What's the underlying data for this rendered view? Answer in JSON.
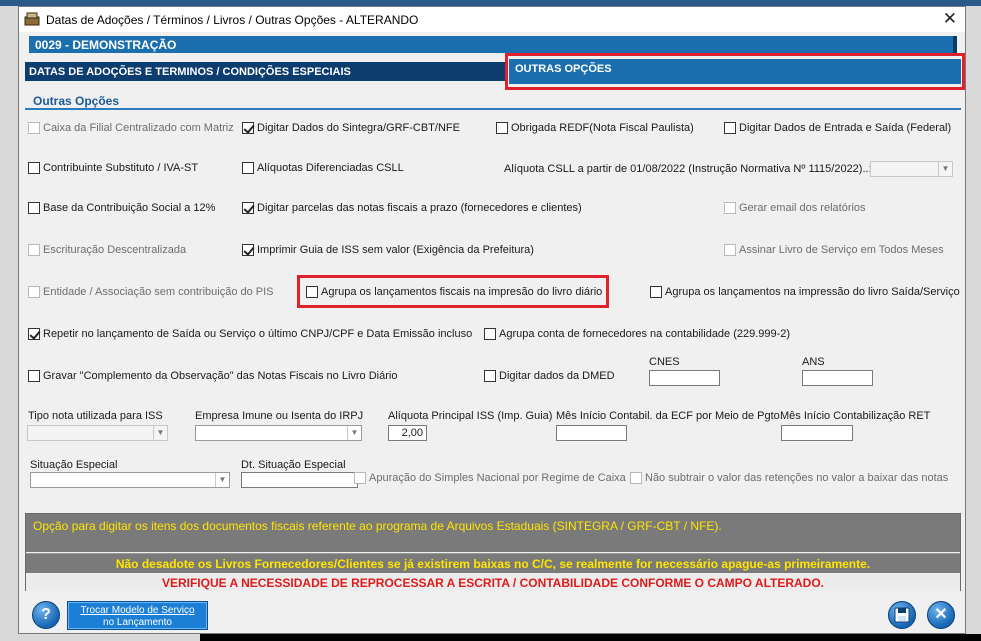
{
  "window": {
    "title": "Datas de Adoções / Términos / Livros / Outras Opções   -   ALTERANDO",
    "close_label": "✕"
  },
  "company": "0029  -  DEMONSTRAÇÃO",
  "tabs": {
    "dates": "DATAS DE ADOÇÕES E TERMINOS / CONDIÇÕES ESPECIAIS",
    "other": "OUTRAS OPÇÕES"
  },
  "section_title": "Outras Opções",
  "checkboxes": {
    "caixa_filial": {
      "label": "Caixa da Filial Centralizado com Matriz",
      "checked": false,
      "disabled": true
    },
    "digitar_sintegra": {
      "label": "Digitar Dados do Sintegra/GRF-CBT/NFE",
      "checked": true,
      "disabled": false
    },
    "obrigada_redf": {
      "label": "Obrigada REDF(Nota Fiscal Paulista)",
      "checked": false,
      "disabled": false
    },
    "digitar_entrada_saida": {
      "label": "Digitar Dados de Entrada e Saída (Federal)",
      "checked": false,
      "disabled": false
    },
    "contribuinte_substituto": {
      "label": "Contribuinte Substituto / IVA-ST",
      "checked": false,
      "disabled": false
    },
    "aliquotas_csll": {
      "label": "Alíquotas Diferenciadas CSLL",
      "checked": false,
      "disabled": false
    },
    "base_contribuicao": {
      "label": "Base da Contribuição Social a 12%",
      "checked": false,
      "disabled": false
    },
    "digitar_parcelas": {
      "label": "Digitar parcelas das notas fiscais a prazo (fornecedores e clientes)",
      "checked": true,
      "disabled": false
    },
    "gerar_email": {
      "label": "Gerar email dos relatórios",
      "checked": false,
      "disabled": true
    },
    "escrituracao": {
      "label": "Escrituração Descentralizada",
      "checked": false,
      "disabled": true
    },
    "imprimir_iss": {
      "label": "Imprimir Guia de ISS sem valor (Exigência da Prefeitura)",
      "checked": true,
      "disabled": false
    },
    "assinar_livro": {
      "label": "Assinar Livro de Serviço em Todos Meses",
      "checked": false,
      "disabled": true
    },
    "entidade": {
      "label": "Entidade / Associação sem contribuição do PIS",
      "checked": false,
      "disabled": true
    },
    "agrupa_diario": {
      "label": "Agrupa os lançamentos fiscais na impresão do livro diário",
      "checked": false,
      "disabled": false
    },
    "agrupa_saida": {
      "label": "Agrupa os lançamentos na impressão do livro Saída/Serviço",
      "checked": false,
      "disabled": false
    },
    "repetir": {
      "label": "Repetir no lançamento de Saída ou Serviço o último CNPJ/CPF e Data Emissão incluso",
      "checked": true,
      "disabled": false
    },
    "agrupa_fornecedores": {
      "label": "Agrupa conta de fornecedores na contabilidade (229.999-2)",
      "checked": false,
      "disabled": false
    },
    "gravar_complemento": {
      "label": "Gravar \"Complemento da Observação\" das Notas Fiscais no Livro Diário",
      "checked": false,
      "disabled": false
    },
    "digitar_dmed": {
      "label": "Digitar dados da DMED",
      "checked": false,
      "disabled": false
    },
    "apuracao_simples": {
      "label": "Apuração do Simples Nacional por Regime de Caixa",
      "checked": false,
      "disabled": true
    },
    "nao_subtrair": {
      "label": "Não subtrair o valor das retenções no valor a baixar das notas",
      "checked": false,
      "disabled": true
    }
  },
  "fields": {
    "aliquota_csll_label": "Alíquota CSLL a partir de 01/08/2022 (Instrução Normativa Nº 1115/2022)..:",
    "cnes_label": "CNES",
    "ans_label": "ANS",
    "tipo_nota_label": "Tipo nota utilizada para ISS",
    "empresa_imune_label": "Empresa Imune ou Isenta do IRPJ",
    "aliquota_principal_label": "Alíquota Principal ISS (Imp. Guia)",
    "aliquota_principal_value": "2,00",
    "mes_inicio_ecf_label": "Mês Início Contabil. da ECF por Meio de Pgto.",
    "mes_inicio_ret_label": "Mês Início Contabilização RET",
    "situacao_especial_label": "Situação Especial",
    "dt_situacao_label": "Dt. Situação Especial"
  },
  "messages": {
    "info": "Opção para digitar os itens dos documentos fiscais referente ao programa de Arquivos Estaduais (SINTEGRA / GRF-CBT / NFE).",
    "warning": "Não desadote os Livros Fornecedores/Clientes se já existirem baixas no C/C, se realmente for necessário apague-as primeiramente.",
    "alert": "VERIFIQUE A NECESSIDADE DE REPROCESSAR A ESCRITA / CONTABILIDADE CONFORME O CAMPO ALTERADO."
  },
  "buttons": {
    "help": "?",
    "trocar_line1": "Trocar Modelo de Serviço",
    "trocar_line2": "no Lançamento",
    "save_icon": "floppy-disk",
    "exit": "✕"
  },
  "colors": {
    "accent": "#1c6fae",
    "dark_tab": "#0d3d6e",
    "highlight": "#e0202a",
    "info_text": "#ffe600",
    "alert_text": "#e01a1a"
  }
}
